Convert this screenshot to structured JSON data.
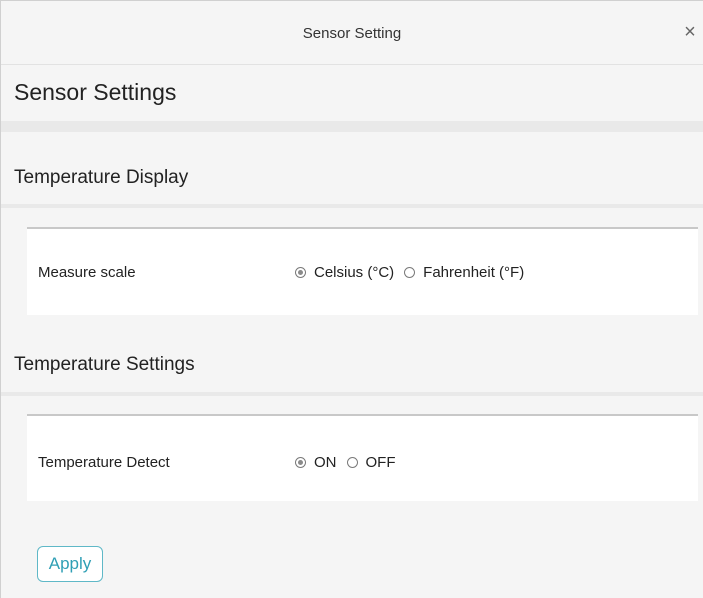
{
  "window": {
    "title": "Sensor Setting",
    "close_icon": "close-icon",
    "close_glyph": "×"
  },
  "page": {
    "title": "Sensor Settings"
  },
  "sections": {
    "display": {
      "title": "Temperature Display",
      "row_label": "Measure scale",
      "options": [
        "Celsius (°C)",
        "Fahrenheit (°F)"
      ],
      "selected": "Celsius (°C)"
    },
    "settings": {
      "title": "Temperature Settings",
      "row_label": "Temperature Detect",
      "options": [
        "ON",
        "OFF"
      ],
      "selected": "ON"
    }
  },
  "actions": {
    "apply_label": "Apply"
  },
  "colors": {
    "accent": "#2f9fb5",
    "background": "#f5f5f5",
    "card": "#ffffff"
  }
}
